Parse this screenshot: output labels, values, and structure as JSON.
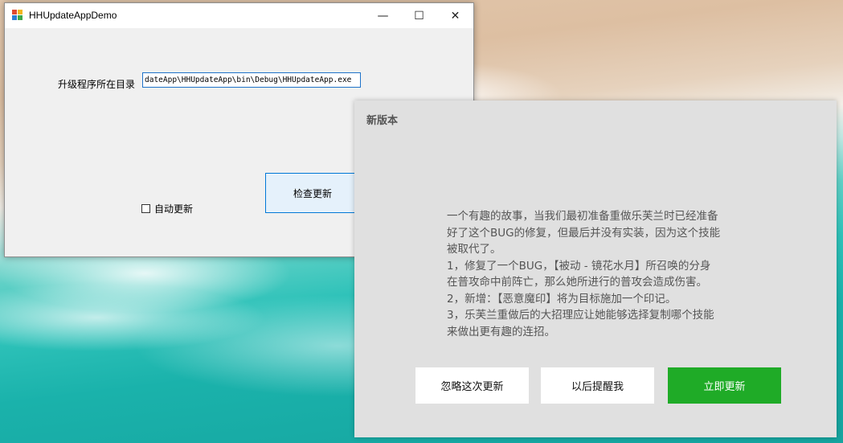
{
  "window": {
    "title": "HHUpdateAppDemo",
    "minimize_glyph": "—",
    "maximize_glyph": "☐",
    "close_glyph": "✕",
    "dir_label": "升级程序所在目录",
    "path_value": "dateApp\\HHUpdateApp\\bin\\Debug\\HHUpdateApp.exe",
    "check_button": "检查更新",
    "auto_update_label": "自动更新",
    "auto_update_checked": false
  },
  "dialog": {
    "title": "新版本",
    "notes": [
      "一个有趣的故事，当我们最初准备重做乐芙兰时已经准备",
      "好了这个BUG的修复，但最后并没有实装，因为这个技能",
      "被取代了。",
      "1，修复了一个BUG，【被动 - 镜花水月】所召唤的分身",
      "在普攻命中前阵亡，那么她所进行的普攻会造成伤害。",
      "2，新增：【恶意魔印】将为目标施加一个印记。",
      "3，乐芙兰重做后的大招理应让她能够选择复制哪个技能",
      "来做出更有趣的连招。"
    ],
    "ignore_button": "忽略这次更新",
    "later_button": "以后提醒我",
    "update_button": "立即更新"
  },
  "colors": {
    "update_button_bg": "#1fab27",
    "dialog_bg": "#e0e0e0",
    "input_border": "#1e73c9"
  }
}
